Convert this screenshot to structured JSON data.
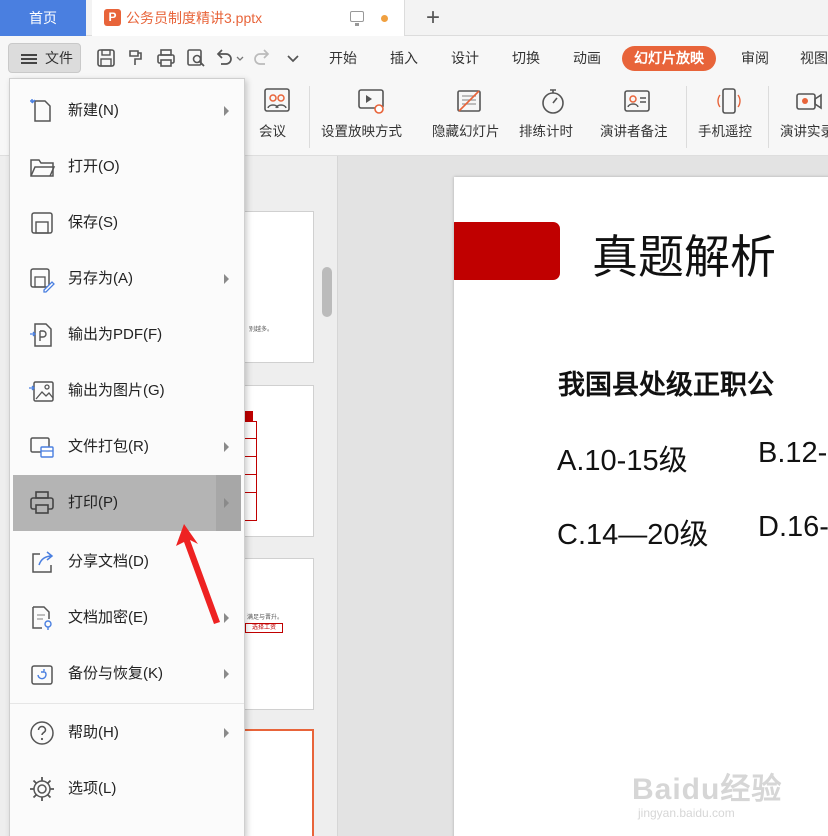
{
  "titlebar": {
    "home_tab": "首页",
    "doc_tab": "公务员制度精讲3.pptx",
    "doc_icon_letter": "P",
    "new_tab_symbol": "+"
  },
  "menubar": {
    "file_label": "文件",
    "tabs": [
      "开始",
      "插入",
      "设计",
      "切换",
      "动画",
      "幻灯片放映",
      "审阅",
      "视图"
    ],
    "active_tab": "幻灯片放映",
    "accent_color": "#e8643a"
  },
  "ribbon": {
    "items": [
      "会议",
      "设置放映方式",
      "隐藏幻灯片",
      "排练计时",
      "演讲者备注",
      "手机遥控",
      "演讲实录"
    ]
  },
  "file_menu": {
    "items": [
      {
        "label": "新建(N)",
        "icon": "new-file-icon",
        "has_submenu": true
      },
      {
        "label": "打开(O)",
        "icon": "folder-icon",
        "has_submenu": false
      },
      {
        "label": "保存(S)",
        "icon": "save-icon",
        "has_submenu": false
      },
      {
        "label": "另存为(A)",
        "icon": "save-as-icon",
        "has_submenu": true
      },
      {
        "label": "输出为PDF(F)",
        "icon": "pdf-icon",
        "has_submenu": false
      },
      {
        "label": "输出为图片(G)",
        "icon": "image-export-icon",
        "has_submenu": false
      },
      {
        "label": "文件打包(R)",
        "icon": "package-icon",
        "has_submenu": true
      },
      {
        "label": "打印(P)",
        "icon": "printer-icon",
        "has_submenu": true,
        "highlighted": true
      },
      {
        "label": "分享文档(D)",
        "icon": "share-icon",
        "has_submenu": false
      },
      {
        "label": "文档加密(E)",
        "icon": "lock-document-icon",
        "has_submenu": true
      },
      {
        "label": "备份与恢复(K)",
        "icon": "backup-icon",
        "has_submenu": true
      },
      {
        "label": "帮助(H)",
        "icon": "help-icon",
        "has_submenu": true
      },
      {
        "label": "选项(L)",
        "icon": "gear-icon",
        "has_submenu": false
      }
    ]
  },
  "slide": {
    "title": "真题解析",
    "question": "我国县处级正职公",
    "options": [
      "A.10-15级",
      "B.12-",
      "C.14—20级",
      "D.16-"
    ],
    "accent_color": "#c00000"
  },
  "thumbnails": {
    "snippet_1": "别越多。",
    "snippet_2": "满足与晋升。",
    "snippet_3": "选择工资"
  },
  "watermark": {
    "brand": "Baidu经验",
    "url": "jingyan.baidu.com"
  }
}
